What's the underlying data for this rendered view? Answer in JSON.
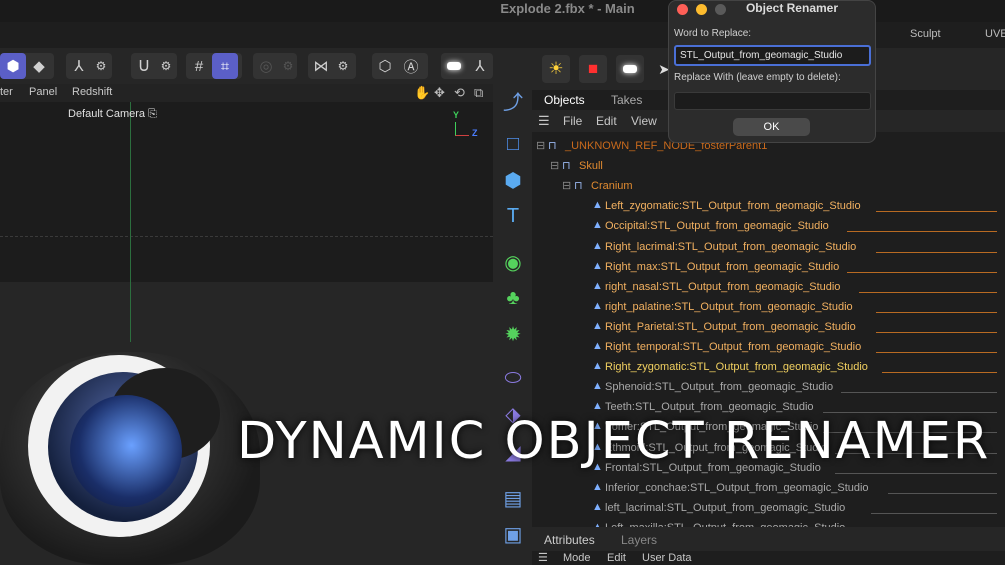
{
  "window": {
    "title": "Explode 2.fbx * - Main"
  },
  "menubar_right": [
    "Sculpt",
    "UVE"
  ],
  "view_menu": {
    "items": [
      "ter",
      "Panel",
      "Redshift"
    ]
  },
  "viewport": {
    "camera_label": "Default Camera",
    "axis_y": "Y",
    "axis_z": "Z"
  },
  "object_manager": {
    "tabs": [
      "Objects",
      "Takes"
    ],
    "menu": [
      "File",
      "Edit",
      "View"
    ],
    "tree": [
      {
        "label": "_UNKNOWN_REF_NODE_fosterParent1",
        "level": 0,
        "type": "null",
        "color": "#c96a1c"
      },
      {
        "label": "Skull",
        "level": 1,
        "type": "null",
        "color": "#e08a30"
      },
      {
        "label": "Cranium",
        "level": 2,
        "type": "null",
        "color": "#e08a30"
      },
      {
        "label": "Left_zygomatic:STL_Output_from_geomagic_Studio",
        "level": 3,
        "type": "mesh",
        "color": "#f1b060"
      },
      {
        "label": "Occipital:STL_Output_from_geomagic_Studio",
        "level": 3,
        "type": "mesh",
        "color": "#f1b060"
      },
      {
        "label": "Right_lacrimal:STL_Output_from_geomagic_Studio",
        "level": 3,
        "type": "mesh",
        "color": "#f1b060"
      },
      {
        "label": "Right_max:STL_Output_from_geomagic_Studio",
        "level": 3,
        "type": "mesh",
        "color": "#f1b060"
      },
      {
        "label": "right_nasal:STL_Output_from_geomagic_Studio",
        "level": 3,
        "type": "mesh",
        "color": "#f1b060"
      },
      {
        "label": "right_palatine:STL_Output_from_geomagic_Studio",
        "level": 3,
        "type": "mesh",
        "color": "#f1b060"
      },
      {
        "label": "Right_Parietal:STL_Output_from_geomagic_Studio",
        "level": 3,
        "type": "mesh",
        "color": "#f1b060"
      },
      {
        "label": "Right_temporal:STL_Output_from_geomagic_Studio",
        "level": 3,
        "type": "mesh",
        "color": "#f1b060"
      },
      {
        "label": "Right_zygomatic:STL_Output_from_geomagic_Studio",
        "level": 3,
        "type": "mesh",
        "color": "#f1d060"
      },
      {
        "label": "Sphenoid:STL_Output_from_geomagic_Studio",
        "level": 3,
        "type": "mesh",
        "color": "#a8a8a8"
      },
      {
        "label": "Teeth:STL_Output_from_geomagic_Studio",
        "level": 3,
        "type": "mesh",
        "color": "#a8a8a8"
      },
      {
        "label": "Vomer:STL_Output_from_geomagic_Studio",
        "level": 3,
        "type": "mesh",
        "color": "#a8a8a8"
      },
      {
        "label": "Ethmoid:STL_Output_from_geomagic_Studio",
        "level": 3,
        "type": "mesh",
        "color": "#a8a8a8"
      },
      {
        "label": "Frontal:STL_Output_from_geomagic_Studio",
        "level": 3,
        "type": "mesh",
        "color": "#a8a8a8"
      },
      {
        "label": "Inferior_conchae:STL_Output_from_geomagic_Studio",
        "level": 3,
        "type": "mesh",
        "color": "#a8a8a8"
      },
      {
        "label": "left_lacrimal:STL_Output_from_geomagic_Studio",
        "level": 3,
        "type": "mesh",
        "color": "#a8a8a8"
      },
      {
        "label": "Left_maxilla:STL_Output_from_geomagic_Studio",
        "level": 3,
        "type": "mesh",
        "color": "#a8a8a8"
      }
    ]
  },
  "attributes": {
    "tabs": [
      "Attributes",
      "Layers"
    ],
    "menu": [
      "Mode",
      "Edit",
      "User Data"
    ]
  },
  "dialog": {
    "title": "Object Renamer",
    "find_label": "Word to Replace:",
    "find_value": "STL_Output_from_geomagic_Studio",
    "replace_label": "Replace With (leave empty to delete):",
    "replace_value": "",
    "ok_label": "OK"
  },
  "overlay": {
    "headline": "DYNAMIC OBJECT RENAMER"
  },
  "colors": {
    "accent": "#5b5fc7",
    "focus": "#4a6fd6",
    "hierarchy": "#e08a30",
    "viewport_axis_y": "#2c6e3e"
  }
}
